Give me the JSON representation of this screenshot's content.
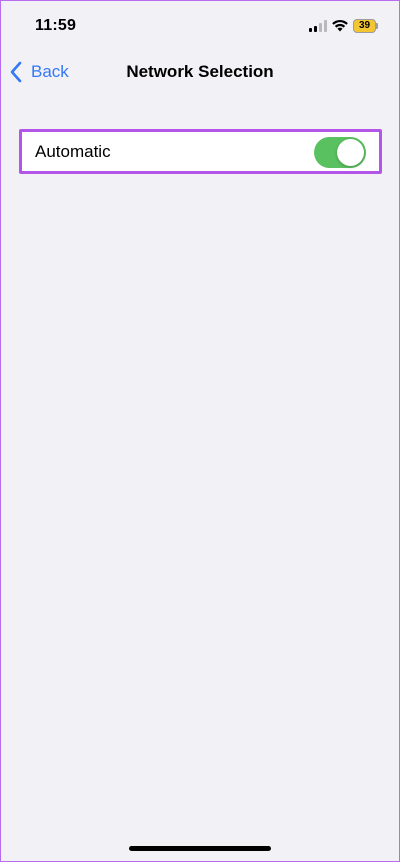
{
  "status_bar": {
    "time": "11:59",
    "battery_level": "39",
    "battery_color": "#f3c631",
    "signal_bars_filled": 2,
    "signal_bars_total": 4,
    "icons": [
      "cell-signal-icon",
      "wifi-icon",
      "battery-icon"
    ]
  },
  "nav": {
    "back_label": "Back",
    "back_icon": "chevron-left-icon",
    "title": "Network Selection",
    "accent_color": "#3478f6"
  },
  "settings": {
    "automatic": {
      "label": "Automatic",
      "enabled": true,
      "toggle_color": "#5ac160"
    }
  },
  "highlight_color": "#b356e8"
}
